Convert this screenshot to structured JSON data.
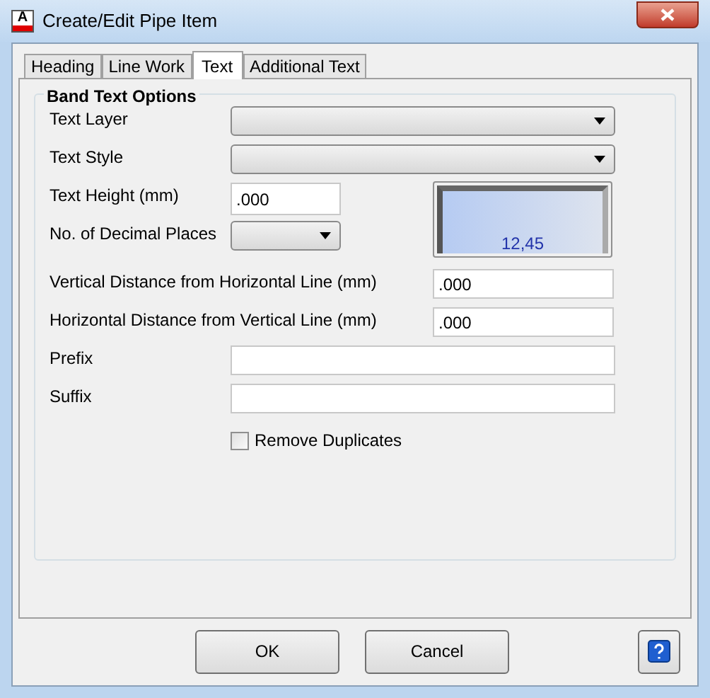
{
  "window": {
    "icon_letter": "A",
    "title": "Create/Edit Pipe Item"
  },
  "tabs": [
    {
      "label": "Heading",
      "selected": false
    },
    {
      "label": "Line Work",
      "selected": false
    },
    {
      "label": "Text",
      "selected": true
    },
    {
      "label": "Additional Text",
      "selected": false
    }
  ],
  "group": {
    "title": "Band Text Options"
  },
  "top_rows": [
    {
      "kind": "dropdown",
      "label": "Text Layer"
    },
    {
      "kind": "dropdown",
      "label": "Text Style"
    },
    {
      "kind": "input",
      "label": "Text Height (mm)",
      "value": ".000"
    },
    {
      "kind": "small_dropdown",
      "label": "No. of Decimal Places"
    }
  ],
  "preview": {
    "sample": "12,45"
  },
  "rows": [
    {
      "kind": "short_input",
      "label": "Vertical Distance from Horizontal Line (mm)",
      "value": ".000"
    },
    {
      "kind": "short_input",
      "label": "Horizontal Distance from Vertical Line (mm)",
      "value": ".000"
    },
    {
      "kind": "wide_input",
      "label": "Prefix"
    },
    {
      "kind": "wide_input",
      "label": "Suffix"
    }
  ],
  "checkbox": {
    "label": "Remove Duplicates",
    "checked": false
  },
  "buttons": [
    {
      "label": "OK"
    },
    {
      "label": "Cancel"
    }
  ]
}
